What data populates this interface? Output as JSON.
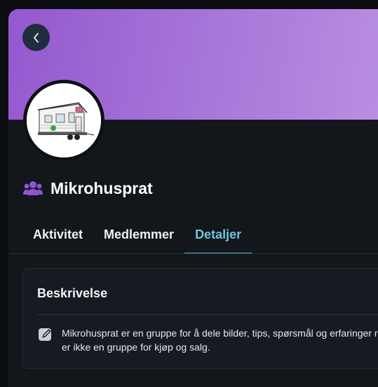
{
  "group": {
    "name": "Mikrohusprat"
  },
  "tabs": [
    {
      "label": "Aktivitet",
      "active": false
    },
    {
      "label": "Medlemmer",
      "active": false
    },
    {
      "label": "Detaljer",
      "active": true
    }
  ],
  "description_card": {
    "title": "Beskrivelse",
    "text": "Mikrohusprat er en gruppe for å dele bilder, tips, spørsmål og erfaringer ru er ikke en gruppe for kjøp og salg."
  },
  "colors": {
    "banner_start": "#9458cf",
    "banner_end": "#b98fe2",
    "accent_tab": "#6ec6d8",
    "group_icon": "#8e55d6"
  },
  "icons": {
    "back": "chevron-left-icon",
    "group": "people-group-icon",
    "edit": "edit-pencil-icon"
  }
}
